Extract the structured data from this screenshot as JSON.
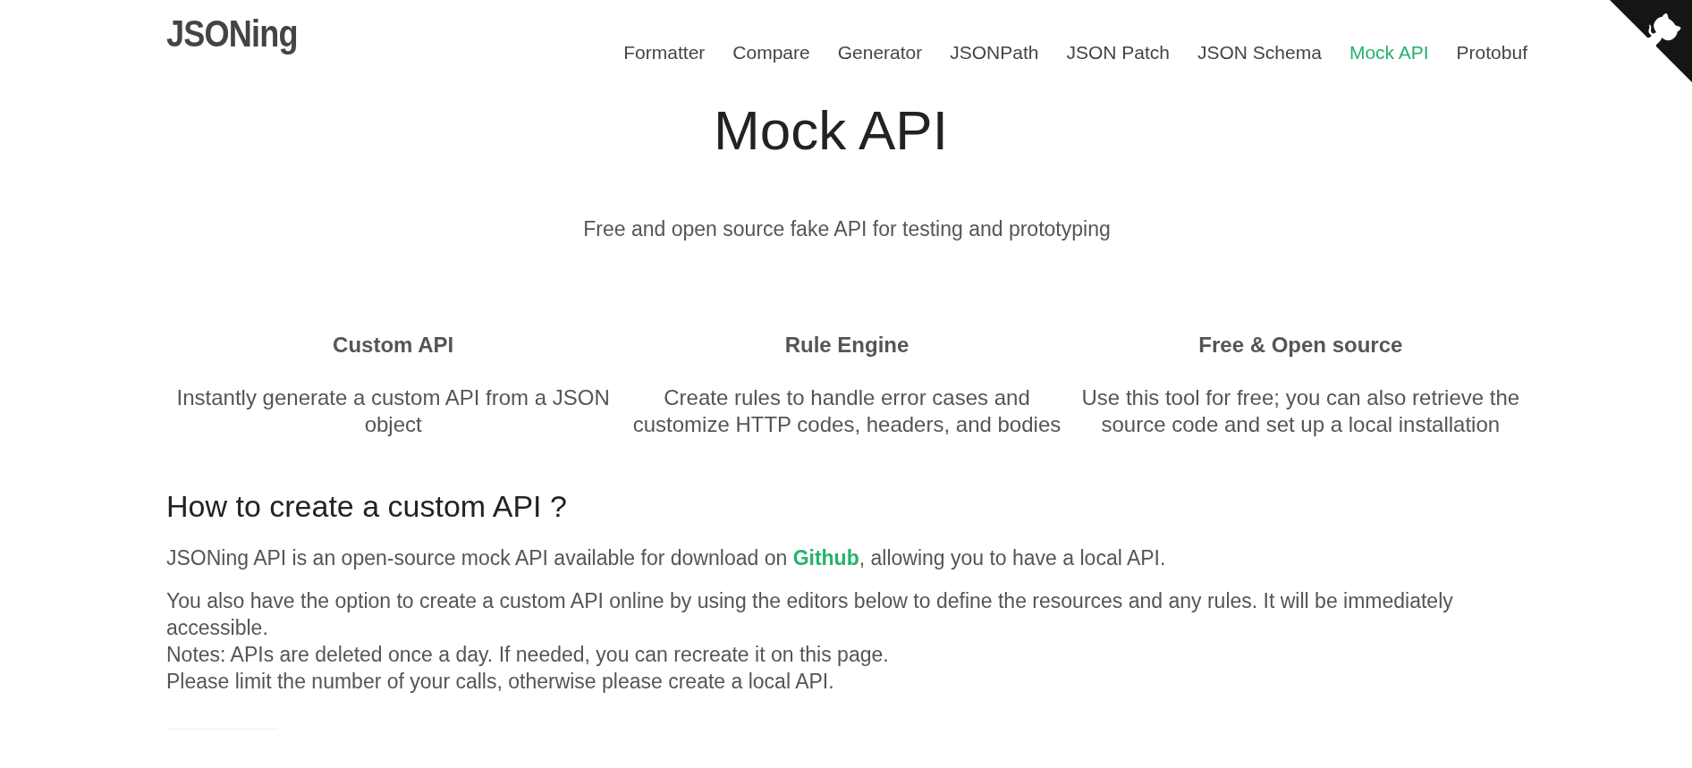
{
  "logo": "JSONing",
  "nav": [
    {
      "label": "Formatter",
      "selected": false
    },
    {
      "label": "Compare",
      "selected": false
    },
    {
      "label": "Generator",
      "selected": false
    },
    {
      "label": "JSONPath",
      "selected": false
    },
    {
      "label": "JSON Patch",
      "selected": false
    },
    {
      "label": "JSON Schema",
      "selected": false
    },
    {
      "label": "Mock API",
      "selected": true
    },
    {
      "label": "Protobuf",
      "selected": false
    }
  ],
  "hero": {
    "title": "Mock API",
    "subtitle": "Free and open source fake API for testing and prototyping"
  },
  "features": [
    {
      "title": "Custom API",
      "text": "Instantly generate a custom API from a JSON object"
    },
    {
      "title": "Rule Engine",
      "text": "Create rules to handle error cases and customize HTTP codes, headers, and bodies"
    },
    {
      "title": "Free & Open source",
      "text": "Use this tool for free; you can also retrieve the source code and set up a local installation"
    }
  ],
  "section": {
    "heading": "How to create a custom API ?",
    "intro": {
      "before": "JSONing API is an open-source mock API available for download on ",
      "link": "Github",
      "after": ", allowing you to have a local API."
    },
    "lines": [
      "You also have the option to create a custom API online by using the editors below to define the resources and any rules. It will be immediately accessible.",
      "Notes: APIs are deleted once a day. If needed, you can recreate it on this page.",
      "Please limit the number of your calls, otherwise please create a local API."
    ]
  }
}
